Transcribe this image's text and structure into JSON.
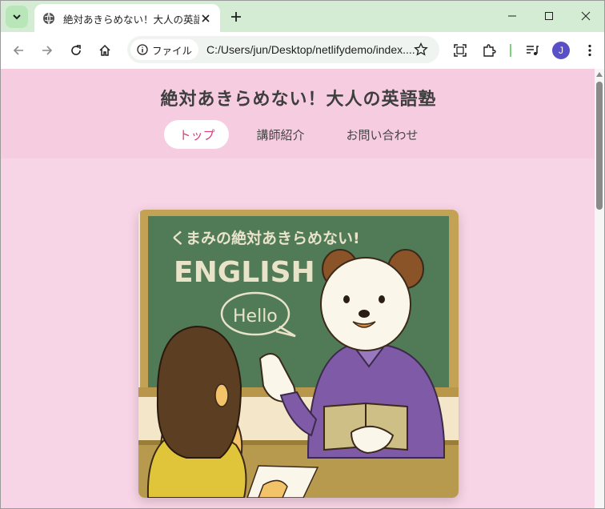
{
  "browser": {
    "tab": {
      "title": "絶対あきらめない！大人の英語塾"
    },
    "omnibox": {
      "chip_label": "ファイル",
      "url": "C:/Users/jun/Desktop/netlifydemo/index...."
    },
    "profile_initial": "J",
    "accent": "#d3ecd3"
  },
  "site": {
    "title": "絶対あきらめない！大人の英語塾",
    "nav": [
      {
        "label": "トップ",
        "active": true
      },
      {
        "label": "講師紹介",
        "active": false
      },
      {
        "label": "お問い合わせ",
        "active": false
      }
    ],
    "hero": {
      "board_line1": "くまみの絶対あきらめない!",
      "board_line2": "ENGLISH",
      "bubble": "Hello"
    },
    "colors": {
      "header_bg": "#f6cde0",
      "page_bg": "#f8d5e6",
      "active_nav": "#d6407a"
    }
  }
}
